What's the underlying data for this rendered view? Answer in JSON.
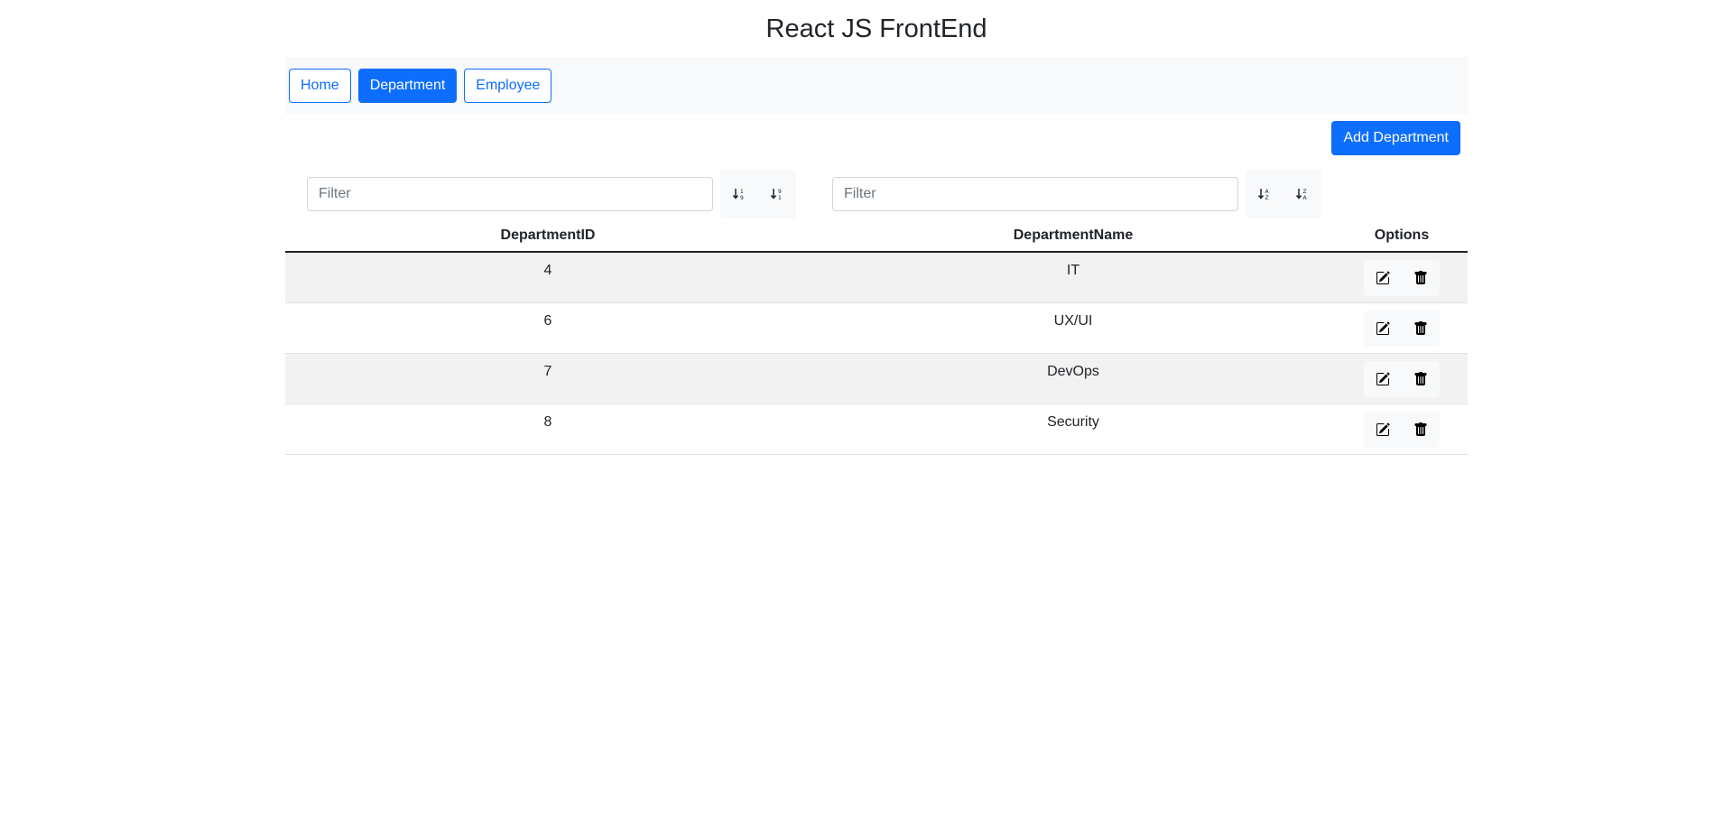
{
  "app": {
    "title": "React JS FrontEnd"
  },
  "nav": {
    "items": [
      {
        "label": "Home",
        "active": false
      },
      {
        "label": "Department",
        "active": true
      },
      {
        "label": "Employee",
        "active": false
      }
    ]
  },
  "toolbar": {
    "add_label": "Add Department"
  },
  "table": {
    "filters": {
      "id_placeholder": "Filter",
      "name_placeholder": "Filter"
    },
    "headers": [
      "DepartmentID",
      "DepartmentName",
      "Options"
    ],
    "rows": [
      {
        "id": "4",
        "name": "IT"
      },
      {
        "id": "6",
        "name": "UX/UI"
      },
      {
        "id": "7",
        "name": "DevOps"
      },
      {
        "id": "8",
        "name": "Security"
      }
    ]
  },
  "icons": {
    "sort_numeric_asc": "sort-numeric-down-icon",
    "sort_numeric_desc": "sort-numeric-up-icon",
    "sort_alpha_asc": "sort-alpha-down-icon",
    "sort_alpha_desc": "sort-alpha-up-icon",
    "edit": "pencil-square-icon",
    "delete": "trash-icon"
  },
  "colors": {
    "primary": "#0d6efd",
    "navbar_bg": "#f8f9fa",
    "stripe": "#f2f2f2"
  }
}
